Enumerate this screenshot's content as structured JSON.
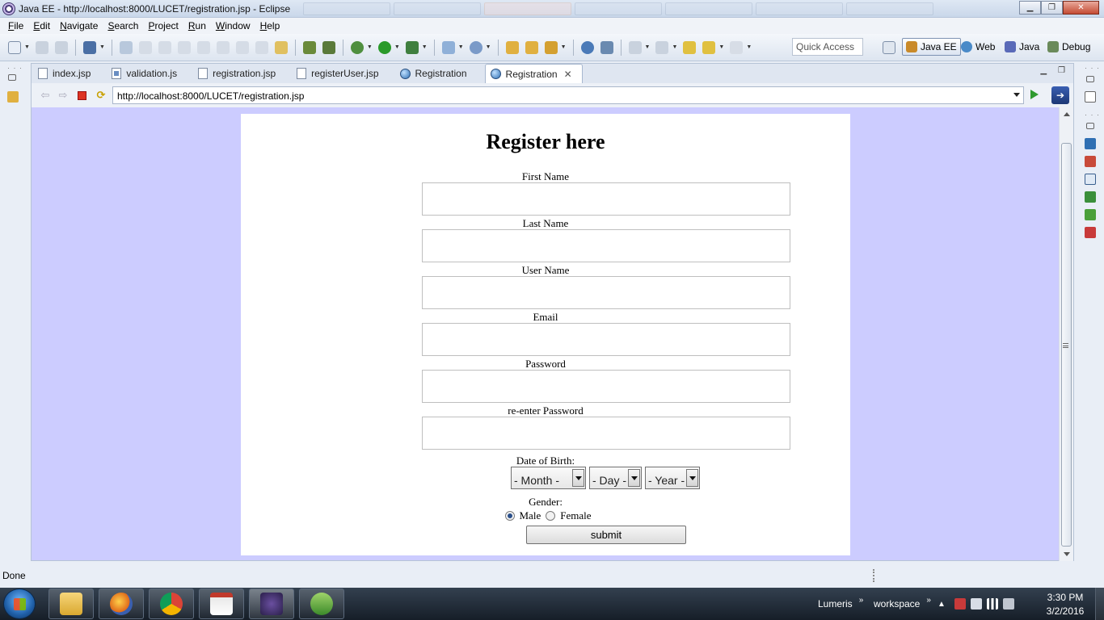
{
  "window": {
    "title": "Java EE - http://localhost:8000/LUCET/registration.jsp - Eclipse",
    "controls": [
      "minimize",
      "restore",
      "close"
    ]
  },
  "menu": [
    "File",
    "Edit",
    "Navigate",
    "Search",
    "Project",
    "Run",
    "Window",
    "Help"
  ],
  "toolbar": {
    "quick_access_placeholder": "Quick Access",
    "perspectives": [
      {
        "label": "Java EE",
        "active": true,
        "icon": "javaee-perspective-icon"
      },
      {
        "label": "Web",
        "active": false,
        "icon": "web-perspective-icon"
      },
      {
        "label": "Java",
        "active": false,
        "icon": "java-perspective-icon"
      },
      {
        "label": "Debug",
        "active": false,
        "icon": "debug-perspective-icon"
      }
    ]
  },
  "editor_tabs": [
    {
      "label": "index.jsp",
      "icon": "jsp-file-icon",
      "active": false
    },
    {
      "label": "validation.js",
      "icon": "js-file-icon",
      "active": false
    },
    {
      "label": "registration.jsp",
      "icon": "jsp-file-icon",
      "active": false
    },
    {
      "label": "registerUser.jsp",
      "icon": "jsp-file-icon",
      "active": false
    },
    {
      "label": "Registration",
      "icon": "globe-icon",
      "active": false
    },
    {
      "label": "Registration",
      "icon": "globe-icon",
      "active": true,
      "closable": true
    }
  ],
  "browser": {
    "url": "http://localhost:8000/LUCET/registration.jsp",
    "background_color": "#ccccff"
  },
  "form": {
    "heading": "Register here",
    "fields": [
      {
        "label": "First Name",
        "value": ""
      },
      {
        "label": "Last Name",
        "value": ""
      },
      {
        "label": "User Name",
        "value": ""
      },
      {
        "label": "Email",
        "value": ""
      },
      {
        "label": "Password",
        "value": ""
      },
      {
        "label": "re-enter Password",
        "value": ""
      }
    ],
    "dob_label": "Date of Birth:",
    "dob_selects": {
      "month": "- Month -",
      "day": "- Day -",
      "year": "- Year -"
    },
    "gender_label": "Gender:",
    "gender_options": [
      {
        "label": "Male",
        "checked": true
      },
      {
        "label": "Female",
        "checked": false
      }
    ],
    "submit_label": "submit"
  },
  "status": {
    "text": "Done"
  },
  "taskbar": {
    "apps": [
      "windows-explorer",
      "firefox",
      "chrome",
      "notepad",
      "java-ee-ide",
      "downloader"
    ],
    "tray": {
      "toolbar_lumeris": "Lumeris",
      "toolbar_workspace": "workspace"
    },
    "clock": {
      "time": "3:30 PM",
      "date": "3/2/2016"
    }
  }
}
